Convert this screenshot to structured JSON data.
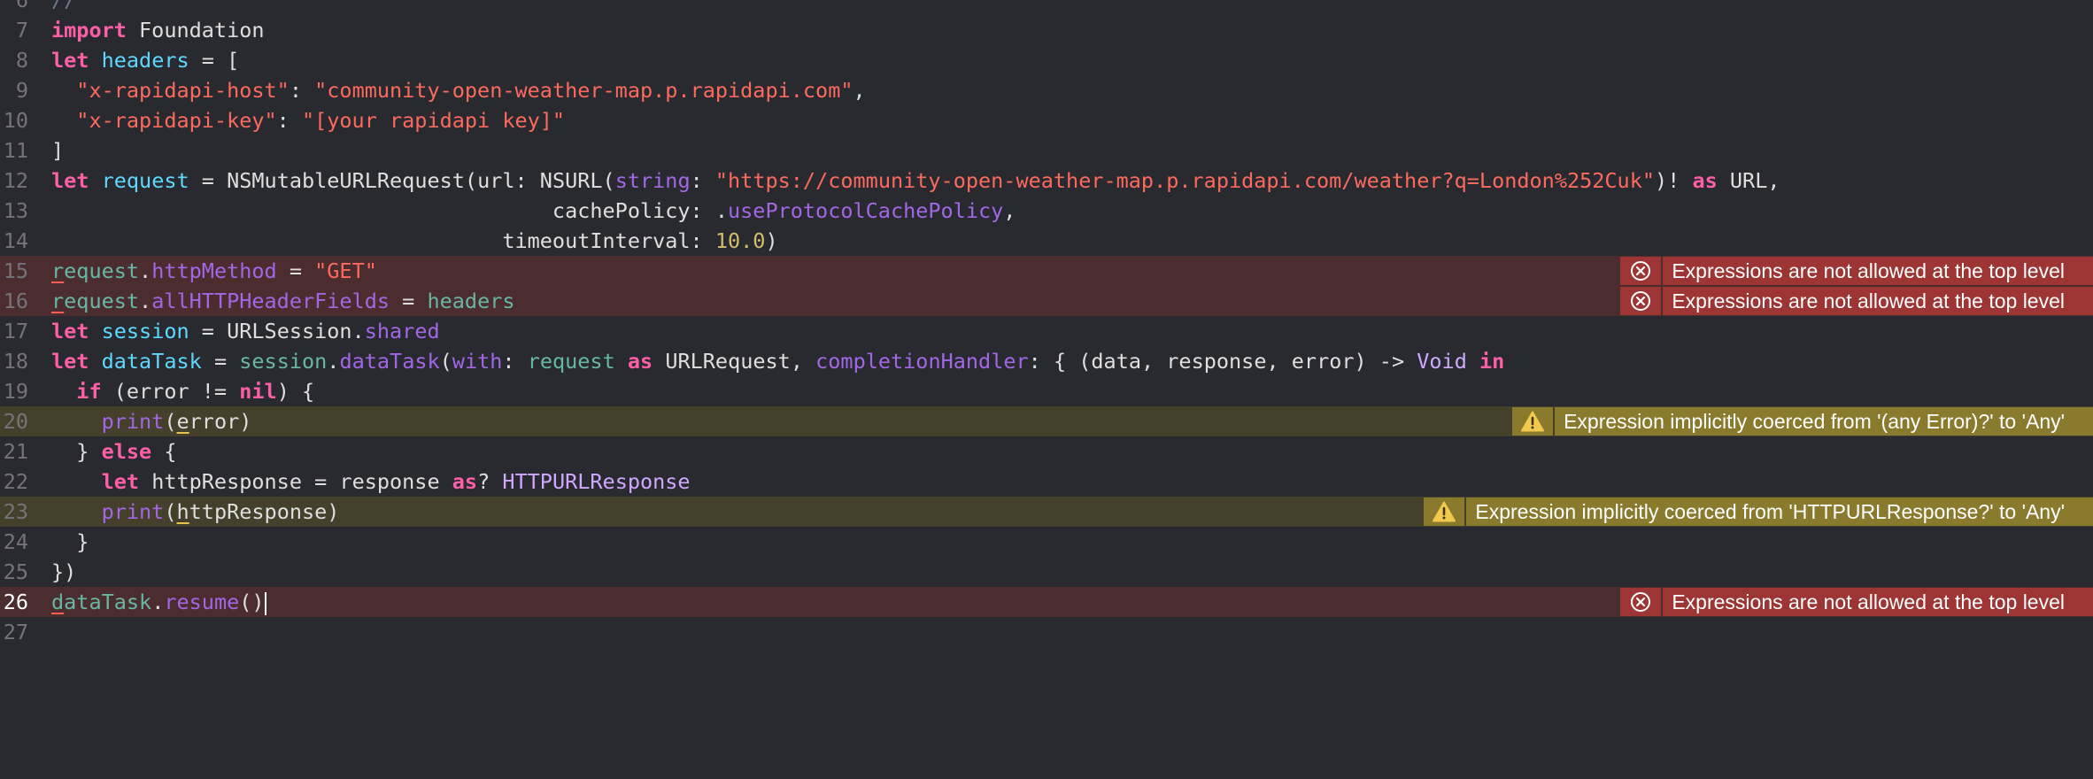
{
  "editor": {
    "language": "Swift",
    "colors": {
      "background": "#292a30",
      "error_line": "#4b2d2f",
      "warning_line": "#44402c",
      "error_badge": "#9e3535",
      "warning_badge": "#8a7a2e"
    },
    "lines": [
      {
        "number": "6",
        "state": "normal",
        "tokens": [
          {
            "t": "//",
            "c": "comment"
          }
        ]
      },
      {
        "number": "7",
        "state": "normal",
        "tokens": [
          {
            "t": "import",
            "c": "keyword"
          },
          {
            "t": " Foundation",
            "c": "default"
          }
        ]
      },
      {
        "number": "8",
        "state": "normal",
        "tokens": [
          {
            "t": "let",
            "c": "keyword"
          },
          {
            "t": " ",
            "c": "default"
          },
          {
            "t": "headers",
            "c": "decl"
          },
          {
            "t": " = [",
            "c": "default"
          }
        ]
      },
      {
        "number": "9",
        "state": "normal",
        "tokens": [
          {
            "t": "  ",
            "c": "default"
          },
          {
            "t": "\"x-rapidapi-host\"",
            "c": "string"
          },
          {
            "t": ": ",
            "c": "default"
          },
          {
            "t": "\"community-open-weather-map.p.rapidapi.com\"",
            "c": "string"
          },
          {
            "t": ",",
            "c": "default"
          }
        ]
      },
      {
        "number": "10",
        "state": "normal",
        "tokens": [
          {
            "t": "  ",
            "c": "default"
          },
          {
            "t": "\"x-rapidapi-key\"",
            "c": "string"
          },
          {
            "t": ": ",
            "c": "default"
          },
          {
            "t": "\"[your rapidapi key]\"",
            "c": "string"
          }
        ]
      },
      {
        "number": "11",
        "state": "normal",
        "tokens": [
          {
            "t": "]",
            "c": "default"
          }
        ]
      },
      {
        "number": "12",
        "state": "normal",
        "tokens": [
          {
            "t": "let",
            "c": "keyword"
          },
          {
            "t": " ",
            "c": "default"
          },
          {
            "t": "request",
            "c": "decl"
          },
          {
            "t": " = NSMutableURLRequest(url: NSURL(",
            "c": "default"
          },
          {
            "t": "string",
            "c": "property"
          },
          {
            "t": ": ",
            "c": "default"
          },
          {
            "t": "\"https://community-open-weather-map.p.rapidapi.com/weather?q=London%252Cuk\"",
            "c": "string"
          },
          {
            "t": ")! ",
            "c": "default"
          },
          {
            "t": "as",
            "c": "keyword"
          },
          {
            "t": " URL,",
            "c": "default"
          }
        ]
      },
      {
        "number": "13",
        "state": "normal",
        "tokens": [
          {
            "t": "                                        cachePolicy: .",
            "c": "default"
          },
          {
            "t": "useProtocolCachePolicy",
            "c": "property"
          },
          {
            "t": ",",
            "c": "default"
          }
        ]
      },
      {
        "number": "14",
        "state": "normal",
        "tokens": [
          {
            "t": "                                    timeoutInterval: ",
            "c": "default"
          },
          {
            "t": "10.0",
            "c": "number"
          },
          {
            "t": ")",
            "c": "default"
          }
        ]
      },
      {
        "number": "15",
        "state": "error",
        "tokens": [
          {
            "t": "r",
            "c": "ident",
            "u": "error"
          },
          {
            "t": "equest",
            "c": "ident"
          },
          {
            "t": ".",
            "c": "default"
          },
          {
            "t": "httpMethod",
            "c": "builtin"
          },
          {
            "t": " = ",
            "c": "default"
          },
          {
            "t": "\"GET\"",
            "c": "string"
          }
        ],
        "annotation": {
          "kind": "error",
          "icon": "error-circle-x-icon",
          "text": "Expressions are not allowed at the top level"
        }
      },
      {
        "number": "16",
        "state": "error",
        "tokens": [
          {
            "t": "r",
            "c": "ident",
            "u": "error"
          },
          {
            "t": "equest",
            "c": "ident"
          },
          {
            "t": ".",
            "c": "default"
          },
          {
            "t": "allHTTPHeaderFields",
            "c": "builtin"
          },
          {
            "t": " = ",
            "c": "default"
          },
          {
            "t": "headers",
            "c": "ident"
          }
        ],
        "annotation": {
          "kind": "error",
          "icon": "error-circle-x-icon",
          "text": "Expressions are not allowed at the top level"
        }
      },
      {
        "number": "17",
        "state": "normal",
        "tokens": [
          {
            "t": "let",
            "c": "keyword"
          },
          {
            "t": " ",
            "c": "default"
          },
          {
            "t": "session",
            "c": "decl"
          },
          {
            "t": " = URLSession.",
            "c": "default"
          },
          {
            "t": "shared",
            "c": "builtin"
          }
        ]
      },
      {
        "number": "18",
        "state": "normal",
        "tokens": [
          {
            "t": "let",
            "c": "keyword"
          },
          {
            "t": " ",
            "c": "default"
          },
          {
            "t": "dataTask",
            "c": "decl"
          },
          {
            "t": " = ",
            "c": "default"
          },
          {
            "t": "session",
            "c": "ident"
          },
          {
            "t": ".",
            "c": "default"
          },
          {
            "t": "dataTask",
            "c": "builtin"
          },
          {
            "t": "(",
            "c": "default"
          },
          {
            "t": "with",
            "c": "builtin"
          },
          {
            "t": ": ",
            "c": "default"
          },
          {
            "t": "request",
            "c": "ident"
          },
          {
            "t": " ",
            "c": "default"
          },
          {
            "t": "as",
            "c": "keyword"
          },
          {
            "t": " URLRequest, ",
            "c": "default"
          },
          {
            "t": "completionHandler",
            "c": "builtin"
          },
          {
            "t": ": { (data, response, error) -> ",
            "c": "default"
          },
          {
            "t": "Void",
            "c": "type"
          },
          {
            "t": " ",
            "c": "default"
          },
          {
            "t": "in",
            "c": "keyword"
          }
        ]
      },
      {
        "number": "19",
        "state": "normal",
        "tokens": [
          {
            "t": "  ",
            "c": "default"
          },
          {
            "t": "if",
            "c": "keyword"
          },
          {
            "t": " (error != ",
            "c": "default"
          },
          {
            "t": "nil",
            "c": "keyword"
          },
          {
            "t": ") {",
            "c": "default"
          }
        ]
      },
      {
        "number": "20",
        "state": "warning",
        "tokens": [
          {
            "t": "    ",
            "c": "default"
          },
          {
            "t": "print",
            "c": "builtin"
          },
          {
            "t": "(",
            "c": "default"
          },
          {
            "t": "e",
            "c": "default",
            "u": "warning"
          },
          {
            "t": "rror)",
            "c": "default"
          }
        ],
        "annotation": {
          "kind": "warning",
          "icon": "warning-triangle-icon",
          "text": "Expression implicitly coerced from '(any Error)?' to 'Any'"
        }
      },
      {
        "number": "21",
        "state": "normal",
        "tokens": [
          {
            "t": "  } ",
            "c": "default"
          },
          {
            "t": "else",
            "c": "keyword"
          },
          {
            "t": " {",
            "c": "default"
          }
        ]
      },
      {
        "number": "22",
        "state": "normal",
        "tokens": [
          {
            "t": "    ",
            "c": "default"
          },
          {
            "t": "let",
            "c": "keyword"
          },
          {
            "t": " httpResponse = response ",
            "c": "default"
          },
          {
            "t": "as",
            "c": "keyword"
          },
          {
            "t": "? ",
            "c": "default"
          },
          {
            "t": "HTTPURLResponse",
            "c": "type"
          }
        ]
      },
      {
        "number": "23",
        "state": "warning",
        "tokens": [
          {
            "t": "    ",
            "c": "default"
          },
          {
            "t": "print",
            "c": "builtin"
          },
          {
            "t": "(",
            "c": "default"
          },
          {
            "t": "h",
            "c": "default",
            "u": "warning"
          },
          {
            "t": "ttpResponse)",
            "c": "default"
          }
        ],
        "annotation": {
          "kind": "warning",
          "icon": "warning-triangle-icon",
          "text": "Expression implicitly coerced from 'HTTPURLResponse?' to 'Any'"
        }
      },
      {
        "number": "24",
        "state": "normal",
        "tokens": [
          {
            "t": "  }",
            "c": "default"
          }
        ]
      },
      {
        "number": "25",
        "state": "normal",
        "tokens": [
          {
            "t": "})",
            "c": "default"
          }
        ]
      },
      {
        "number": "26",
        "state": "error",
        "current": true,
        "cursor": true,
        "tokens": [
          {
            "t": "d",
            "c": "ident",
            "u": "error"
          },
          {
            "t": "ataTask",
            "c": "ident"
          },
          {
            "t": ".",
            "c": "default"
          },
          {
            "t": "resume",
            "c": "builtin"
          },
          {
            "t": "()",
            "c": "default"
          }
        ],
        "annotation": {
          "kind": "error",
          "icon": "error-circle-x-icon",
          "text": "Expressions are not allowed at the top level"
        }
      },
      {
        "number": "27",
        "state": "normal",
        "tokens": []
      }
    ]
  }
}
